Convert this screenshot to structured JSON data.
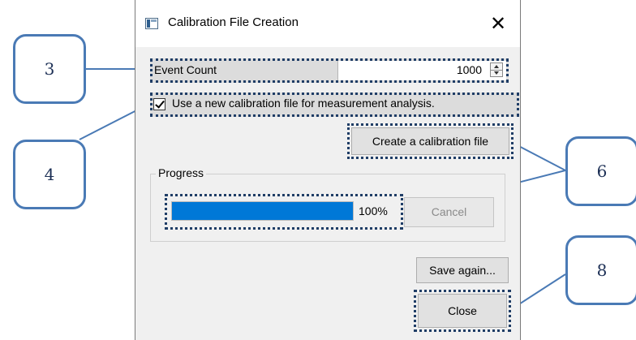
{
  "window": {
    "title": "Calibration File Creation",
    "close_glyph": "✕"
  },
  "event_count": {
    "label": "Event Count",
    "value": "1000"
  },
  "use_new_file": {
    "label": "Use a new calibration file for measurement analysis.",
    "checked": true
  },
  "buttons": {
    "create": "Create a calibration file",
    "cancel": "Cancel",
    "save_again": "Save again...",
    "close": "Close"
  },
  "progress": {
    "group_title": "Progress",
    "percent_text": "100%",
    "value": 1.0,
    "fill_color": "#0078d7"
  },
  "callouts": {
    "c3": "3",
    "c4": "4",
    "c6": "6",
    "c8": "8"
  },
  "colors": {
    "callout_border": "#4a7ab5",
    "dotted_highlight": "#1f3d66"
  },
  "icons": {
    "app": "app-window-icon",
    "close": "close-icon",
    "spin_up": "spin-up-arrow-icon",
    "spin_down": "spin-down-arrow-icon",
    "check": "checkmark-icon"
  }
}
